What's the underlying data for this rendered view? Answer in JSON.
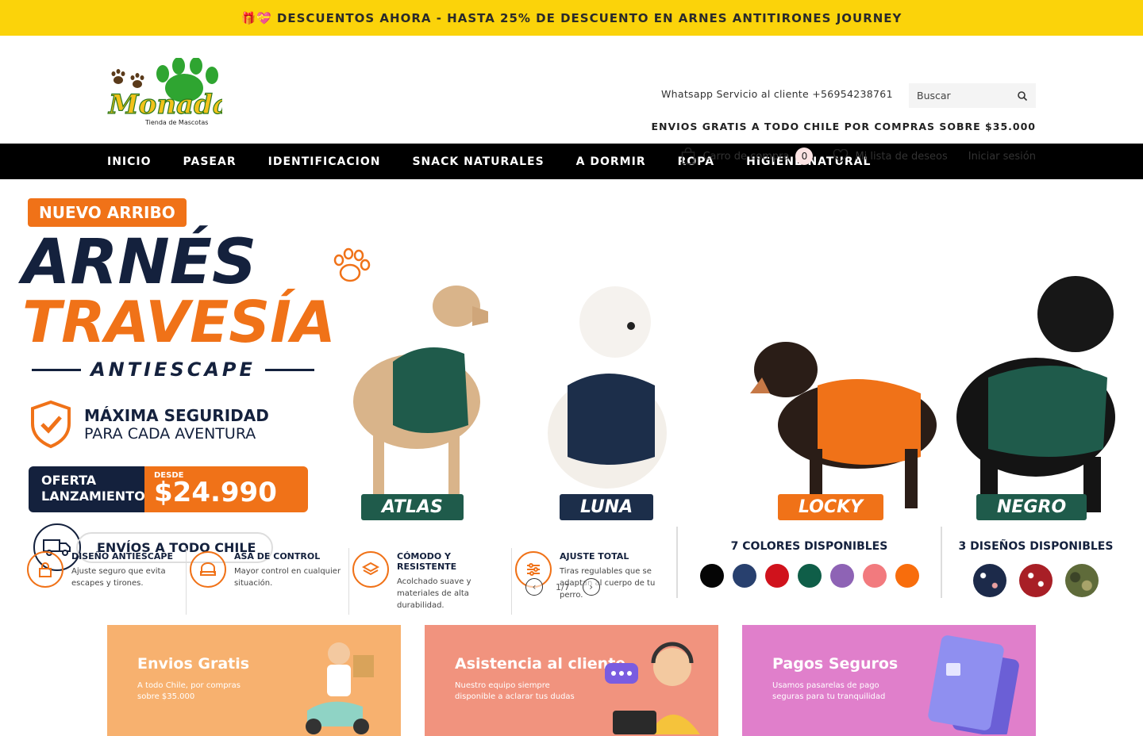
{
  "announcement": {
    "icons": "🎁💝",
    "text": "DESCUENTOS AHORA - HASTA 25% DE DESCUENTO EN ARNES ANTITIRONES JOURNEY"
  },
  "header": {
    "logo_text": "Monadas",
    "logo_subtitle": "Tienda de Mascotas",
    "whatsapp": "Whatsapp Servicio al cliente +56954238761",
    "search_placeholder": "Buscar",
    "shipping_note": "ENVIOS GRATIS A TODO CHILE POR COMPRAS SOBRE $35.000",
    "cart_label": "Carro de compra",
    "cart_count": "0",
    "wishlist_label": "Mi lista de deseos",
    "login_label": "Iniciar sesión"
  },
  "nav": {
    "items": [
      "INICIO",
      "PASEAR",
      "IDENTIFICACION",
      "SNACK NATURALES",
      "A DORMIR",
      "ROPA",
      "HIGIENE NATURAL"
    ]
  },
  "hero": {
    "badge": "NUEVO ARRIBO",
    "title_1": "ARNÉS",
    "title_2": "TRAVESÍA",
    "title_3": "ANTIESCAPE",
    "security_title": "MÁXIMA SEGURIDAD",
    "security_sub": "PARA CADA AVENTURA",
    "offer_label": "OFERTA LANZAMIENTO",
    "offer_desde": "DESDE",
    "offer_price": "$24.990",
    "shipping": "ENVÍOS A TODO CHILE",
    "dogs": [
      {
        "name": "ATLAS",
        "color": "#1f5b4b"
      },
      {
        "name": "LUNA",
        "color": "#1c2e4a"
      },
      {
        "name": "LOCKY",
        "color": "#f07218"
      },
      {
        "name": "NEGRO",
        "color": "#1f5b4b"
      }
    ],
    "features": [
      {
        "title": "DISEÑO ANTIESCAPE",
        "desc": "Ajuste seguro que evita escapes y tirones."
      },
      {
        "title": "ASA DE CONTROL",
        "desc": "Mayor control en cualquier situación."
      },
      {
        "title": "CÓMODO Y RESISTENTE",
        "desc": "Acolchado suave y materiales de alta durabilidad."
      },
      {
        "title": "AJUSTE TOTAL",
        "desc": "Tiras regulables que se adaptan al cuerpo de tu perro."
      }
    ],
    "colors_title": "7 COLORES DISPONIBLES",
    "colors": [
      "#050505",
      "#28406e",
      "#d0121c",
      "#0f5e48",
      "#8e63b5",
      "#f27a7e",
      "#f86d0c"
    ],
    "designs_title": "3 DISEÑOS DISPONIBLES",
    "designs": [
      "#1c2a4a",
      "#a81f26",
      "#5f6b3a"
    ],
    "slide_counter": "1/7"
  },
  "promos": [
    {
      "title": "Envios Gratis",
      "desc": "A todo Chile, por compras sobre $35.000",
      "bg": "#f7b16f"
    },
    {
      "title": "Asistencia al cliente",
      "desc": "Nuestro equipo siempre disponible a aclarar tus dudas",
      "bg": "#f1937e"
    },
    {
      "title": "Pagos Seguros",
      "desc": "Usamos pasarelas de pago seguras para tu tranquilidad",
      "bg": "#e07fcb"
    }
  ]
}
